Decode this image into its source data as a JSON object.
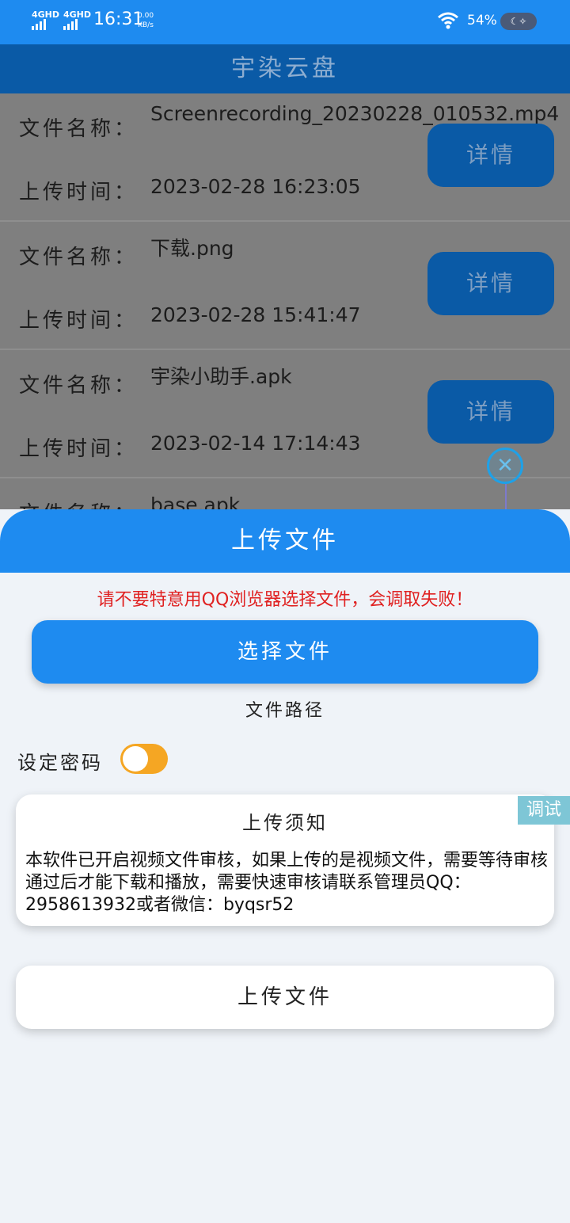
{
  "status_bar": {
    "network1": "4GHD",
    "network2": "4GHD",
    "time": "16:31",
    "speed_value": "0.00",
    "speed_unit": "KB/s",
    "battery": "54%"
  },
  "app": {
    "title": "宇染云盘"
  },
  "files": [
    {
      "name_label": "文件名称：",
      "name": "Screenrecording_20230228_010532.mp4",
      "time_label": "上传时间：",
      "time": "2023-02-28 16:23:05",
      "detail": "详情"
    },
    {
      "name_label": "文件名称：",
      "name": "下载.png",
      "time_label": "上传时间：",
      "time": "2023-02-28 15:41:47",
      "detail": "详情"
    },
    {
      "name_label": "文件名称：",
      "name": "宇染小助手.apk",
      "time_label": "上传时间：",
      "time": "2023-02-14 17:14:43",
      "detail": "详情"
    },
    {
      "name_label": "文件名称：",
      "name": "base.apk",
      "time_label": "",
      "time": "",
      "detail": ""
    }
  ],
  "sheet": {
    "title": "上传文件",
    "warning": "请不要特意用QQ浏览器选择文件，会调取失败！",
    "select_button": "选择文件",
    "file_path": "文件路径",
    "password_label": "设定密码",
    "password_enabled": true,
    "notice_title": "上传须知",
    "notice_body": "本软件已开启视频文件审核，如果上传的是视频文件，需要等待审核通过后才能下载和播放，需要快速审核请联系管理员QQ：2958613932或者微信：byqsr52",
    "debug_tag": "调试",
    "upload_button": "上传文件"
  },
  "colors": {
    "primary": "#1e8bf0",
    "toolbar_dim": "#0a5aa6",
    "warning": "#e02121",
    "toggle_on": "#f5a623"
  }
}
